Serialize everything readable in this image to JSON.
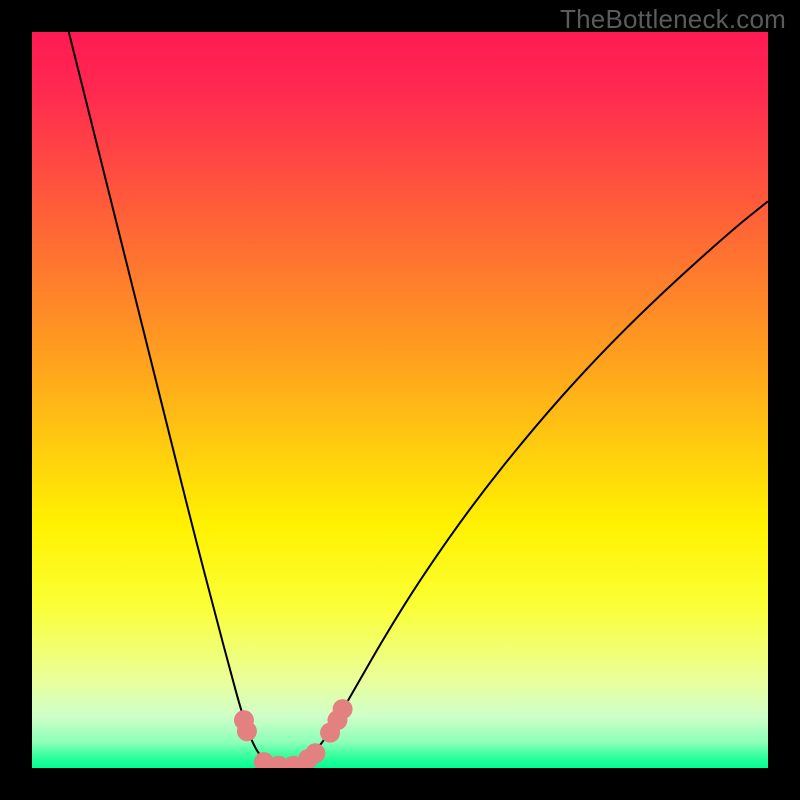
{
  "watermark": "TheBottleneck.com",
  "chart_data": {
    "type": "line",
    "title": "",
    "xlabel": "",
    "ylabel": "",
    "xlim": [
      0,
      100
    ],
    "ylim": [
      0,
      100
    ],
    "background": {
      "kind": "vertical-gradient",
      "stops": [
        {
          "pos": 0.0,
          "color": "#ff1a53"
        },
        {
          "pos": 0.08,
          "color": "#ff2950"
        },
        {
          "pos": 0.2,
          "color": "#ff503f"
        },
        {
          "pos": 0.33,
          "color": "#ff7b2d"
        },
        {
          "pos": 0.46,
          "color": "#ffa61c"
        },
        {
          "pos": 0.58,
          "color": "#ffd20d"
        },
        {
          "pos": 0.67,
          "color": "#fff200"
        },
        {
          "pos": 0.78,
          "color": "#fbff36"
        },
        {
          "pos": 0.88,
          "color": "#eaff9a"
        },
        {
          "pos": 0.93,
          "color": "#cfffc9"
        },
        {
          "pos": 0.965,
          "color": "#8cffb8"
        },
        {
          "pos": 0.985,
          "color": "#30ff9d"
        },
        {
          "pos": 1.0,
          "color": "#00ff91"
        }
      ]
    },
    "series": [
      {
        "name": "bottleneck-curve",
        "color": "#000000",
        "stroke_width": 2,
        "points": [
          {
            "x": 5.0,
            "y": 100.0
          },
          {
            "x": 7.0,
            "y": 92.0
          },
          {
            "x": 10.0,
            "y": 80.0
          },
          {
            "x": 13.0,
            "y": 68.0
          },
          {
            "x": 16.0,
            "y": 56.0
          },
          {
            "x": 19.0,
            "y": 44.0
          },
          {
            "x": 22.0,
            "y": 32.0
          },
          {
            "x": 25.0,
            "y": 20.5
          },
          {
            "x": 27.0,
            "y": 13.0
          },
          {
            "x": 28.5,
            "y": 7.5
          },
          {
            "x": 30.0,
            "y": 3.2
          },
          {
            "x": 31.5,
            "y": 1.0
          },
          {
            "x": 33.0,
            "y": 0.2
          },
          {
            "x": 35.0,
            "y": 0.2
          },
          {
            "x": 37.0,
            "y": 0.9
          },
          {
            "x": 39.0,
            "y": 2.8
          },
          {
            "x": 41.0,
            "y": 5.8
          },
          {
            "x": 44.0,
            "y": 11.0
          },
          {
            "x": 48.0,
            "y": 18.0
          },
          {
            "x": 53.0,
            "y": 26.0
          },
          {
            "x": 60.0,
            "y": 36.0
          },
          {
            "x": 68.0,
            "y": 46.0
          },
          {
            "x": 76.0,
            "y": 55.0
          },
          {
            "x": 85.0,
            "y": 64.0
          },
          {
            "x": 95.0,
            "y": 73.0
          },
          {
            "x": 100.0,
            "y": 77.0
          }
        ]
      }
    ],
    "markers": {
      "name": "highlighted-points",
      "color": "#e38080",
      "radius_px": 10,
      "points": [
        {
          "x": 28.8,
          "y": 6.5
        },
        {
          "x": 29.2,
          "y": 5.0
        },
        {
          "x": 31.5,
          "y": 0.8
        },
        {
          "x": 33.5,
          "y": 0.3
        },
        {
          "x": 35.5,
          "y": 0.3
        },
        {
          "x": 37.5,
          "y": 1.2
        },
        {
          "x": 38.5,
          "y": 2.0
        },
        {
          "x": 40.5,
          "y": 4.8
        },
        {
          "x": 41.5,
          "y": 6.5
        },
        {
          "x": 42.2,
          "y": 8.0
        }
      ]
    }
  }
}
